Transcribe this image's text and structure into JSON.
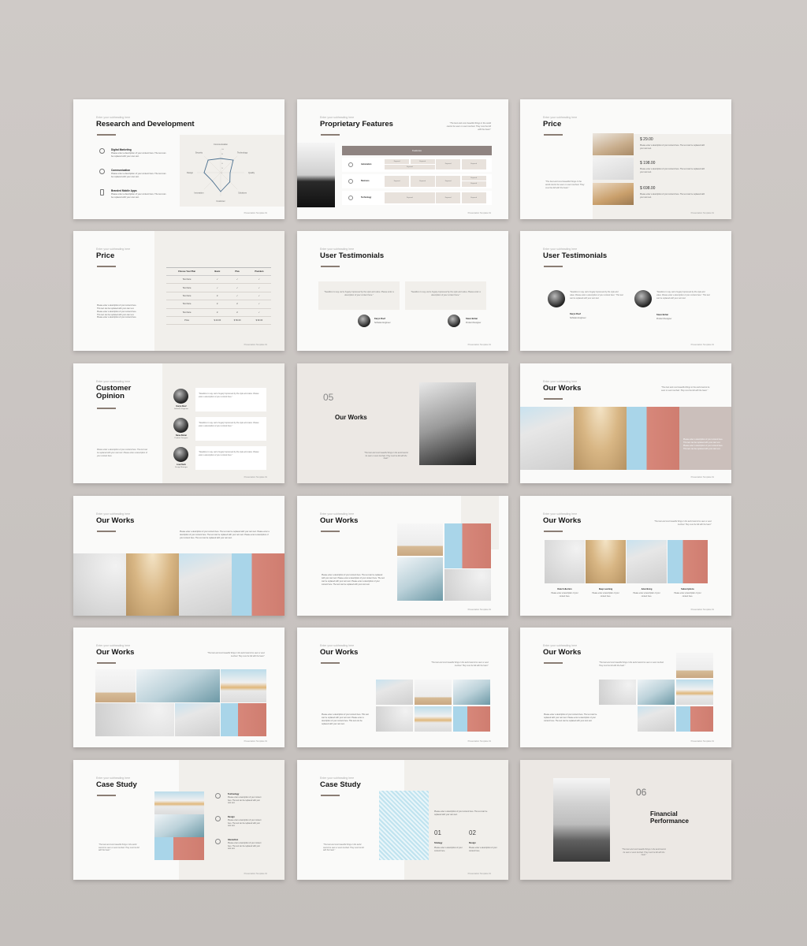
{
  "common": {
    "subtitle": "Enter your subheading here",
    "footer": "Presentation Template  01"
  },
  "slides": {
    "rd": {
      "title": "Research and Development",
      "items": [
        {
          "icon": "target-icon",
          "title": "Digital Marketing",
          "desc": "Please enter a description of your content here. The text can be replaced with your own text."
        },
        {
          "icon": "chat-icon",
          "title": "Communication",
          "desc": "Please enter a description of your content here. The text can be replaced with your own text."
        },
        {
          "icon": "phone-icon",
          "title": "Branded Mobile Apps",
          "desc": "Please enter a description of your content here. The text can be replaced with your own text."
        }
      ]
    },
    "pf": {
      "title": "Proprietary Features",
      "quote": "\"The best and most beautiful things in the world cannot be seen or even touched. They must be felt with the heart.\"",
      "header": "Features",
      "rows": [
        {
          "label": "Automation",
          "icon": "gear-icon"
        },
        {
          "label": "Business",
          "icon": "briefcase-icon"
        },
        {
          "label": "Technology",
          "icon": "cloud-icon"
        }
      ],
      "cell": "Keyword"
    },
    "price1": {
      "title": "Price",
      "quote": "\"The best and most beautiful things in the world cannot be seen or even touched. They must be felt with the heart.\"",
      "items": [
        {
          "price": "$ 29.00",
          "desc": "Please enter a description of your content here. The text can be replaced with your own text."
        },
        {
          "price": "$ 198.00",
          "desc": "Please enter a description of your content here. The text can be replaced with your own text."
        },
        {
          "price": "$ 698.00",
          "desc": "Please enter a description of your content here. The text can be replaced with your own text."
        }
      ]
    },
    "price2": {
      "title": "Price",
      "desc": "Please enter a description of your content here. This text can be replaced with your own text. Please enter a description of your content here. This text can be replaced with your own text. Please enter a description of your content here.",
      "headers": [
        "Choose Your Plan",
        "Basic",
        "Plus",
        "Premium"
      ],
      "rows": [
        [
          "Text here",
          "✓",
          "✓",
          "✓"
        ],
        [
          "Text here",
          "✓",
          "✓",
          "✓"
        ],
        [
          "Text here",
          "✗",
          "✓",
          "✓"
        ],
        [
          "Text here",
          "✗",
          "✗",
          "✓"
        ],
        [
          "Text here",
          "✗",
          "✗",
          "✓"
        ],
        [
          "Price",
          "$ 20.00",
          "$ 50.00",
          "$ 90.00"
        ]
      ]
    },
    "ut1": {
      "title": "User Testimonials",
      "quote": "\"Needless to say, we're hugely impressed by the style and value. Please enter a description of your content here.\"",
      "people": [
        {
          "name": "Karyn Roof",
          "role": "Software Engineer"
        },
        {
          "name": "Steve Bohar",
          "role": "Product Designer"
        }
      ]
    },
    "ut2": {
      "title": "User Testimonials",
      "quote": "\"Needless to say, we're hugely impressed by the style and value. Please enter a description of your content here.\" This text can be replaced with your own text.",
      "people": [
        {
          "name": "Karyn Roof",
          "role": "Software Engineer"
        },
        {
          "name": "Steve Bohar",
          "role": "Product Designer"
        }
      ]
    },
    "co": {
      "title": "Customer Opinion",
      "desc": "Please enter a description of your content here. The text can be replaced with your own text. Please enter a description of your content here.",
      "quote": "\"Needless to say, we're hugely impressed by the style and value. Please enter a description of your content here.\"",
      "people": [
        {
          "name": "Karyn Roof",
          "role": "Software Engineer"
        },
        {
          "name": "Steve Bohar",
          "role": "Product Designer"
        },
        {
          "name": "Lisa Fleck",
          "role": "Design Manager"
        }
      ]
    },
    "sec05": {
      "number": "05",
      "title": "Our Works",
      "quote": "\"The best and most beautiful things in the world cannot be seen or even touched. They must be felt with the heart.\""
    },
    "ow1": {
      "title": "Our Works",
      "quote": "\"The best and most beautiful things in the world cannot be seen or even touched. They must be felt with the heart.\"",
      "desc": "Please enter a description of your content here. This text can be replaced with your own text. Please enter a description of your content here. This text can be replaced with your own text."
    },
    "ow2": {
      "title": "Our Works",
      "desc": "Please enter a description of your content here. The text can be replaced with your own text. Please enter a description of your content here. The text can be replaced with your own text. Please enter a description of your content here. The text can be replaced with your own text."
    },
    "ow3": {
      "title": "Our Works",
      "desc": "Please enter a description of your content here. The text can be replaced with your own text. Please enter a description of your content here. The text can be replaced with your own text. Please enter a description of your content here. The text can be replaced with your own text."
    },
    "ow4": {
      "title": "Our Works",
      "quote": "\"The best and most beautiful things in the world cannot be seen or even touched. They must be felt with the heart.\"",
      "items": [
        {
          "title": "Data Collection",
          "desc": "Please enter a description of your content here."
        },
        {
          "title": "Deep Learning",
          "desc": "Please enter a description of your content here."
        },
        {
          "title": "Advertising",
          "desc": "Please enter a description of your content here."
        },
        {
          "title": "Subscriptions",
          "desc": "Please enter a description of your content here."
        }
      ]
    },
    "ow5": {
      "title": "Our Works",
      "quote": "\"The best and most beautiful things in the world cannot be seen or even touched. They must be felt with the heart.\""
    },
    "ow6": {
      "title": "Our Works",
      "quote": "\"The best and most beautiful things in the world cannot be seen or even touched. They must be felt with the heart.\"",
      "desc": "Please enter a description of your content here. This text can be replaced with your own text. Please enter a description of your content here. This text can be replaced with your own text."
    },
    "ow7": {
      "title": "Our Works",
      "quote": "\"The best and most beautiful things in the world cannot be seen or even touched. They must be felt with the heart.\"",
      "desc": "Please enter a description of your content here. The text can be replaced with your own text. Please enter a description of your content here. The text can be replaced with your own text."
    },
    "cs1": {
      "title": "Case Study",
      "quote": "\"The best and most beautiful things in the world cannot be seen or even touched. They must be felt with the heart.\"",
      "items": [
        {
          "icon": "diamond-icon",
          "title": "Technology",
          "desc": "Please enter a description of your content here. The text can be replaced with your own text."
        },
        {
          "icon": "laurel-icon",
          "title": "Design",
          "desc": "Please enter a description of your content here. The text can be replaced with your own text."
        },
        {
          "icon": "interaction-icon",
          "title": "Interaction",
          "desc": "Please enter a description of your content here. The text can be replaced with your own text."
        }
      ]
    },
    "cs2": {
      "title": "Case Study",
      "quote": "\"The best and most beautiful things in the world cannot be seen or even touched. They must be felt with the heart.\"",
      "desc": "Please enter a description of your content here. The text can be replaced with your own text.",
      "steps": [
        {
          "num": "01",
          "title": "Strategy",
          "desc": "Please enter a description of your content here."
        },
        {
          "num": "02",
          "title": "Design",
          "desc": "Please enter a description of your content here."
        }
      ]
    },
    "sec06": {
      "number": "06",
      "title": "Financial Performance",
      "quote": "\"The best and most beautiful things in the world cannot be seen or even touched. They must be felt with the heart.\""
    }
  },
  "chart_data": {
    "type": "radar",
    "title": "",
    "categories": [
      "Communication",
      "Technology",
      "Quality",
      "Solutions",
      "Customer",
      "Innovation",
      "Design",
      "Security"
    ],
    "values": [
      60,
      75,
      40,
      55,
      80,
      50,
      70,
      75
    ],
    "rlim": [
      0,
      100
    ],
    "ticks": [
      0,
      20,
      40,
      60,
      80,
      100
    ],
    "color": "#4a6f8f"
  }
}
